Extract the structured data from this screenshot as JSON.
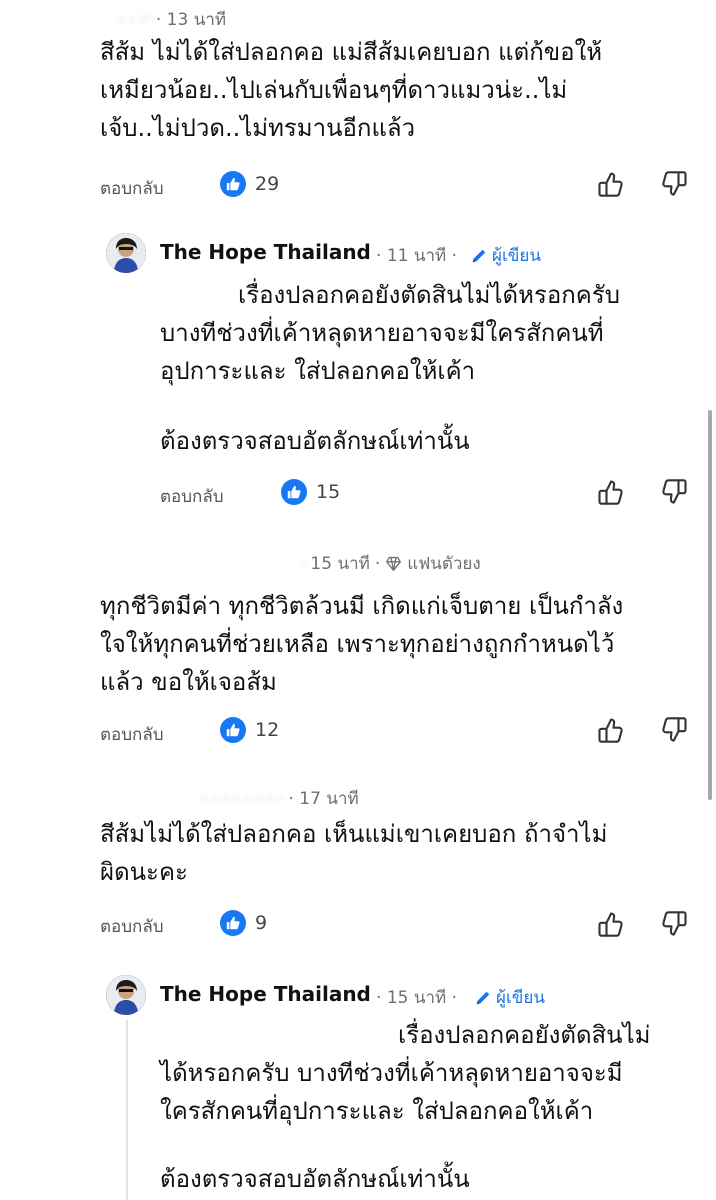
{
  "comments": [
    {
      "time": "13 นาที",
      "lines": [
        "สีส้ม ไม่ได้ใส่ปลอกคอ แม่สีส้มเคยบอก แต่ก้ขอให้",
        "เหมียวน้อย..ไปเล่นกับเพื่อนๆที่ดาวแมวน่ะ..ไม่",
        "เจ้บ..ไม่ปวด..ไม่ทรมานอีกแล้ว"
      ],
      "reply_label": "ตอบกลับ",
      "likes": "29"
    },
    {
      "author": "The Hope Thailand",
      "time": "11 นาที",
      "badge": "ผู้เขียน",
      "lines": [
        "เรื่องปลอกคอยังตัดสินไม่ได้หรอกครับ",
        "บางทีช่วงที่เค้าหลุดหายอาจจะมีใครสักคนที่",
        "อุปการะและ ใส่ปลอกคอให้เค้า",
        "ต้องตรวจสอบอัตลักษณ์เท่านั้น"
      ],
      "reply_label": "ตอบกลับ",
      "likes": "15"
    },
    {
      "time": "15 นาที",
      "badge": "แฟนตัวยง",
      "lines": [
        "ทุกชีวิตมีค่า ทุกชีวิตล้วนมี เกิดแก่เจ็บตาย เป็นกำลัง",
        "ใจให้ทุกคนที่ช่วยเหลือ เพราะทุกอย่างถูกกำหนดไว้",
        "แล้ว ขอให้เจอส้ม"
      ],
      "reply_label": "ตอบกลับ",
      "likes": "12"
    },
    {
      "time": "17 นาที",
      "lines": [
        "สีส้มไม่ได้ใส่ปลอกคอ เห็นแม่เขาเคยบอก ถ้าจำไม่",
        "ผิดนะคะ"
      ],
      "reply_label": "ตอบกลับ",
      "likes": "9"
    },
    {
      "author": "The Hope Thailand",
      "time": "15 นาที",
      "badge": "ผู้เขียน",
      "lines": [
        "เรื่องปลอกคอยังตัดสินไม่",
        "ได้หรอกครับ  บางทีช่วงที่เค้าหลุดหายอาจจะมี",
        "ใครสักคนที่อุปการะและ ใส่ปลอกคอให้เค้า",
        "ต้องตรวจสอบอัตลักษณ์เท่านั้น"
      ]
    }
  ],
  "colors": {
    "like_blue": "#1877f2",
    "author_blue": "#1b74e4",
    "meta_gray": "#6b6f73"
  },
  "icons": [
    "like-badge-icon",
    "thumbs-up-icon",
    "thumbs-down-icon",
    "pencil-icon",
    "diamond-icon"
  ]
}
